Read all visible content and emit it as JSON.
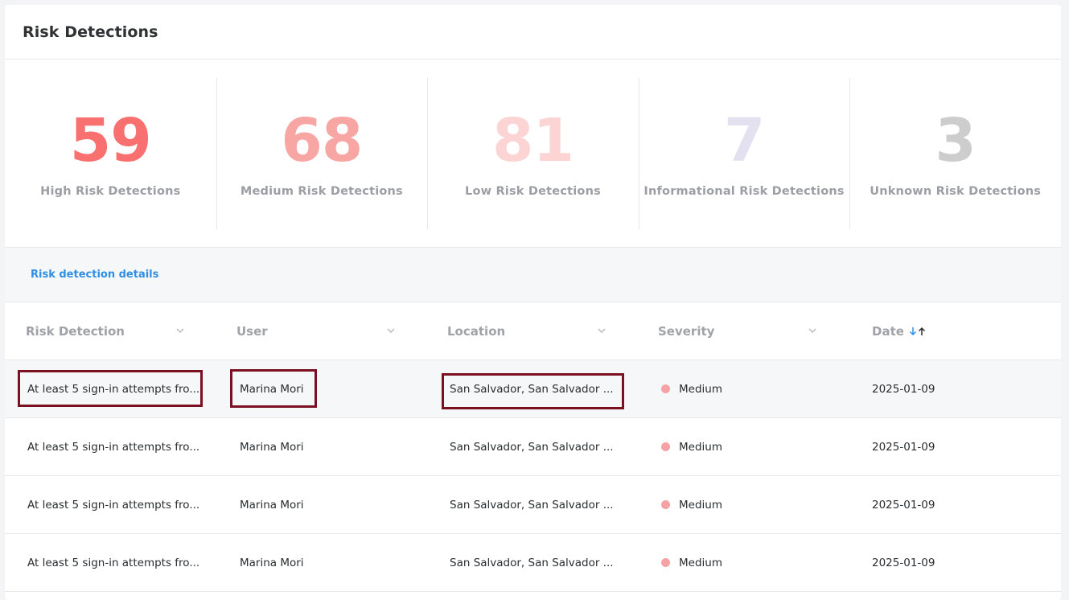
{
  "panel": {
    "title": "Risk Detections"
  },
  "stats": [
    {
      "value": "59",
      "label": "High Risk Detections",
      "color": "#f87070"
    },
    {
      "value": "68",
      "label": "Medium Risk Detections",
      "color": "#f8a6a3"
    },
    {
      "value": "81",
      "label": "Low Risk Detections",
      "color": "#fbd4d3"
    },
    {
      "value": "7",
      "label": "Informational Risk Detections",
      "color": "#e3e1ef"
    },
    {
      "value": "3",
      "label": "Unknown Risk Detections",
      "color": "#cdcdcd"
    }
  ],
  "details": {
    "link_label": "Risk detection details"
  },
  "table": {
    "columns": [
      "Risk Detection",
      "User",
      "Location",
      "Severity",
      "Date"
    ],
    "sort_icons": [
      "arrow-down-icon",
      "arrow-up-icon"
    ],
    "rows": [
      {
        "detection": "At least 5 sign-in attempts fro...",
        "user": "Marina Mori",
        "location": "San Salvador, San Salvador ...",
        "severity": "Medium",
        "date": "2025-01-09"
      },
      {
        "detection": "At least 5 sign-in attempts fro...",
        "user": "Marina Mori",
        "location": "San Salvador, San Salvador ...",
        "severity": "Medium",
        "date": "2025-01-09"
      },
      {
        "detection": "At least 5 sign-in attempts fro...",
        "user": "Marina Mori",
        "location": "San Salvador, San Salvador ...",
        "severity": "Medium",
        "date": "2025-01-09"
      },
      {
        "detection": "At least 5 sign-in attempts fro...",
        "user": "Marina Mori",
        "location": "San Salvador, San Salvador ...",
        "severity": "Medium",
        "date": "2025-01-09"
      }
    ]
  },
  "colors": {
    "accent_link": "#2f8fe3",
    "severity_medium": "#f4a2a4",
    "highlight_border": "#7b1020"
  }
}
